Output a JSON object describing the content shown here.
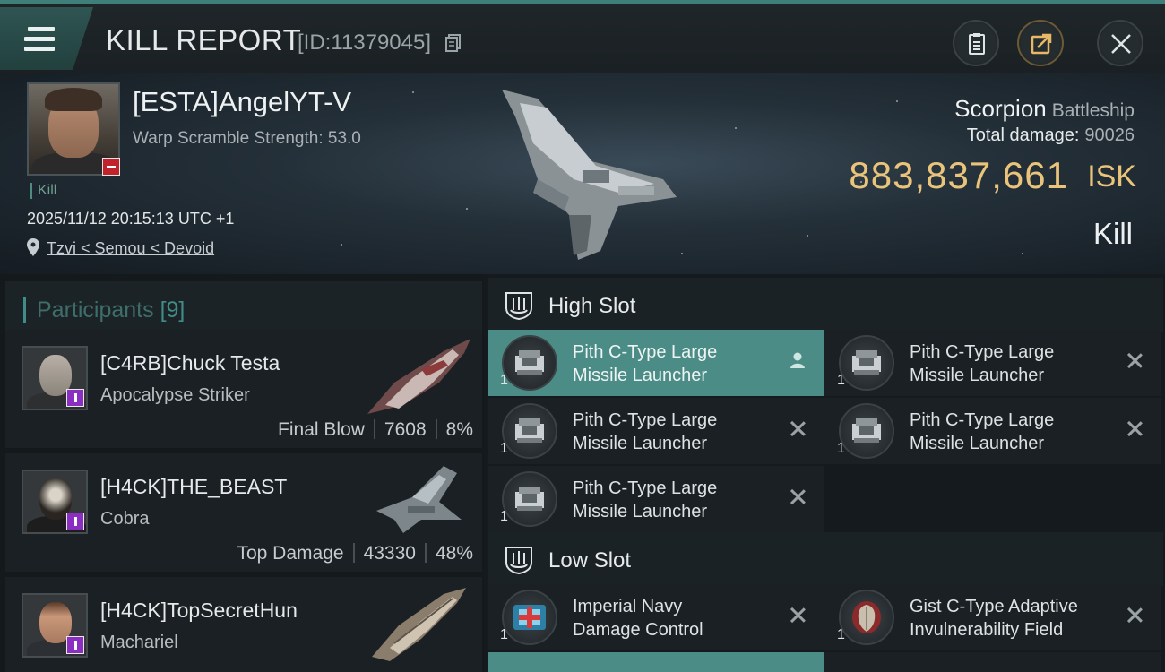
{
  "header": {
    "title": "KILL REPORT",
    "report_id": "[ID:11379045]"
  },
  "victim": {
    "name": "[ESTA]AngelYT-V",
    "warp_scramble": "Warp Scramble Strength: 53.0",
    "tag": "Kill",
    "datetime": "2025/11/12 20:15:13 UTC +1",
    "location": "Tzvi < Semou < Devoid",
    "ship_name": "Scorpion",
    "ship_class": "Battleship",
    "total_damage_label": "Total damage:",
    "total_damage_value": "90026",
    "isk_value": "883,837,661",
    "isk_unit": "ISK",
    "result": "Kill"
  },
  "participants": {
    "label": "Participants",
    "count": "[9]",
    "rows": [
      {
        "name": "[C4RB]Chuck Testa",
        "ship": "Apocalypse Striker",
        "tag": "Final Blow",
        "damage": "7608",
        "percent": "8%"
      },
      {
        "name": "[H4CK]THE_BEAST",
        "ship": "Cobra",
        "tag": "Top Damage",
        "damage": "43330",
        "percent": "48%"
      },
      {
        "name": "[H4CK]TopSecretHun",
        "ship": "Machariel"
      }
    ]
  },
  "fitting": {
    "high_slot_label": "High Slot",
    "low_slot_label": "Low Slot",
    "high": [
      {
        "name_line1": "Pith C-Type Large",
        "name_line2": "Missile Launcher",
        "qty": "1",
        "state": "user-icon"
      },
      {
        "name_line1": "Pith C-Type Large",
        "name_line2": "Missile Launcher",
        "qty": "1",
        "state": "x-icon"
      },
      {
        "name_line1": "Pith C-Type Large",
        "name_line2": "Missile Launcher",
        "qty": "1",
        "state": "x-icon"
      },
      {
        "name_line1": "Pith C-Type Large",
        "name_line2": "Missile Launcher",
        "qty": "1",
        "state": "x-icon"
      },
      {
        "name_line1": "Pith C-Type Large",
        "name_line2": "Missile Launcher",
        "qty": "1",
        "state": "x-icon"
      }
    ],
    "low": [
      {
        "name_line1": "Imperial Navy",
        "name_line2": "Damage Control",
        "qty": "1",
        "state": "x-icon"
      },
      {
        "name_line1": "Gist C-Type Adaptive",
        "name_line2": "Invulnerability Field",
        "qty": "1",
        "state": "x-icon"
      }
    ]
  },
  "colors": {
    "accent": "#4b8d86",
    "isk": "#eac47a",
    "badge_victim": "#c0232b",
    "badge_attacker": "#8a2fc2"
  }
}
